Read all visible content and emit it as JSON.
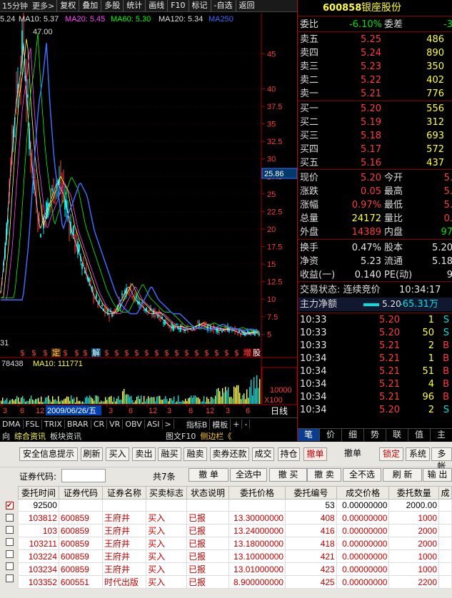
{
  "topbar": {
    "period": "15分钟",
    "more": "更多>",
    "buttons": [
      "复权",
      "叠加",
      "多股",
      "统计",
      "画线",
      "F10",
      "标记",
      "-自选",
      "返回"
    ]
  },
  "ma": {
    "open": "5.24",
    "ma10": "MA10: 5.37",
    "ma20": "MA20: 5.45",
    "ma60": "MA60: 5.30",
    "ma120": "MA120: 5.34",
    "ma250": "MA250",
    "peak": "47.00",
    "low": "31",
    "price_tag": "25.86",
    "date": "2009/06/26/五",
    "axis_ticks": [
      "3",
      "6",
      "12",
      "3",
      "6",
      "12",
      "3",
      "6",
      "12",
      "3",
      "6"
    ]
  },
  "chart_data": {
    "type": "candlestick",
    "y_ticks": [
      45,
      40,
      37.5,
      35,
      32.5,
      30,
      27.5,
      25,
      22.5,
      20,
      17.5,
      15,
      12.5,
      10,
      7.5,
      5
    ],
    "ylim": [
      3,
      49
    ],
    "vol_label": "78438",
    "vol_ma10": "MA10: 111771",
    "vol_tick": "10000",
    "vol_unit": "X100",
    "markers": [
      "$",
      "$",
      "$",
      "$",
      "$",
      "$",
      "$",
      "$",
      "$",
      "$",
      "$",
      "$",
      "$",
      "$",
      "$",
      "$",
      "$",
      "$",
      "$",
      "$"
    ]
  },
  "events": {
    "ding": "定",
    "jie": "解",
    "zeng": "增",
    "bei": "股"
  },
  "tabs": [
    "DMA",
    "FSL",
    "TRIX",
    "BRAR",
    "CR",
    "VR",
    "OBV",
    "ASI",
    ">"
  ],
  "tabs_right": [
    "指标B",
    "模板",
    "+",
    "-"
  ],
  "tab_x_label": "日线",
  "ind2": [
    "向",
    "综合资讯",
    "板块资讯"
  ],
  "ind2_right": [
    "图文F10",
    "侧边栏《"
  ],
  "stock": {
    "code": "600858",
    "name": "银座股份"
  },
  "wei": {
    "wb_label": "委比",
    "wb_val": "-6.10%",
    "wc_label": "委差",
    "wc_val": "-3"
  },
  "sells": [
    {
      "l": "卖五",
      "p": "5.25",
      "v": "486"
    },
    {
      "l": "卖四",
      "p": "5.24",
      "v": "890"
    },
    {
      "l": "卖三",
      "p": "5.23",
      "v": "350"
    },
    {
      "l": "卖二",
      "p": "5.22",
      "v": "402"
    },
    {
      "l": "卖一",
      "p": "5.21",
      "v": "776"
    }
  ],
  "buys": [
    {
      "l": "买一",
      "p": "5.20",
      "v": "556"
    },
    {
      "l": "买二",
      "p": "5.19",
      "v": "312"
    },
    {
      "l": "买三",
      "p": "5.18",
      "v": "693"
    },
    {
      "l": "买四",
      "p": "5.17",
      "v": "572"
    },
    {
      "l": "买五",
      "p": "5.16",
      "v": "437"
    }
  ],
  "quote": [
    {
      "l": "现价",
      "v": "5.20",
      "l2": "今开",
      "v2": "5."
    },
    {
      "l": "涨跌",
      "v": "0.05",
      "l2": "最高",
      "v2": "5."
    },
    {
      "l": "涨幅",
      "v": "0.97%",
      "l2": "最低",
      "v2": "5."
    },
    {
      "l": "总量",
      "v": "24172",
      "l2": "量比",
      "v2": "0."
    },
    {
      "l": "外盘",
      "v": "14389",
      "l2": "内盘",
      "v2": "97"
    }
  ],
  "fund": [
    {
      "l": "换手",
      "v": "0.47%",
      "l2": "股本",
      "v2": "5.20"
    },
    {
      "l": "净资",
      "v": "5.23",
      "l2": "流通",
      "v2": "5.18"
    },
    {
      "l": "收益(一)",
      "v": "0.140",
      "l2": "PE(动)",
      "v2": "9"
    }
  ],
  "status": {
    "label": "交易状态: 连续竞价",
    "time": "10:34:17"
  },
  "mainflow": {
    "label": "主力净额",
    "price": "5.20",
    "value": "-65.31万"
  },
  "ticks": [
    {
      "t": "10:33",
      "p": "5.20",
      "v": "1",
      "s": "S"
    },
    {
      "t": "10:33",
      "p": "5.20",
      "v": "50",
      "s": "S"
    },
    {
      "t": "10:33",
      "p": "5.21",
      "v": "2",
      "s": "B"
    },
    {
      "t": "10:34",
      "p": "5.21",
      "v": "1",
      "s": "B"
    },
    {
      "t": "10:34",
      "p": "5.21",
      "v": "51",
      "s": "B"
    },
    {
      "t": "10:34",
      "p": "5.21",
      "v": "4",
      "s": "B"
    },
    {
      "t": "10:34",
      "p": "5.21",
      "v": "96",
      "s": "B"
    },
    {
      "t": "10:34",
      "p": "5.20",
      "v": "2",
      "s": "S"
    }
  ],
  "rtabs": [
    "笔",
    "价",
    "细",
    "势",
    "联",
    "值",
    "主"
  ],
  "toolbar1": [
    "安全信息提示",
    "刷新",
    "买入",
    "卖出",
    "融买",
    "融卖",
    "卖券还款",
    "成交",
    "持仓",
    "撤单",
    "撤单",
    "锁定",
    "系统",
    "多帐"
  ],
  "toolbar2": {
    "code_label": "证券代码:",
    "count": "共7条",
    "b": [
      "撤 单",
      "全选中",
      "撤 买",
      "撤 卖",
      "全不选",
      "刷 新",
      "输 出"
    ]
  },
  "table": {
    "headers": [
      "委托时间",
      "证券代码",
      "证券名称",
      "买卖标志",
      "状态说明",
      "委托价格",
      "委托编号",
      "成交价格",
      "委托数量",
      "成"
    ],
    "rows": [
      [
        "92500",
        "",
        "",
        "",
        "",
        "",
        "53",
        "0.00000000",
        "2000.00",
        ""
      ],
      [
        "103812",
        "600859",
        "王府井",
        "买入",
        "已报",
        "13.30000000",
        "408",
        "0.00000000",
        "1000",
        ""
      ],
      [
        "103",
        "600859",
        "王府井",
        "买入",
        "已报",
        "13.24000000",
        "416",
        "0.00000000",
        "2000",
        ""
      ],
      [
        "103211",
        "600859",
        "王府井",
        "买入",
        "已报",
        "13.18000000",
        "418",
        "0.00000000",
        "2000",
        ""
      ],
      [
        "103224",
        "600859",
        "王府井",
        "买入",
        "已报",
        "13.10000000",
        "421",
        "0.00000000",
        "1000",
        ""
      ],
      [
        "103234",
        "600859",
        "王府井",
        "买入",
        "已报",
        "13.01000000",
        "423",
        "0.00000000",
        "1000",
        ""
      ],
      [
        "103352",
        "600551",
        "时代出版",
        "买入",
        "已报",
        "8.900000000",
        "425",
        "0.00000000",
        "2200",
        ""
      ]
    ]
  }
}
